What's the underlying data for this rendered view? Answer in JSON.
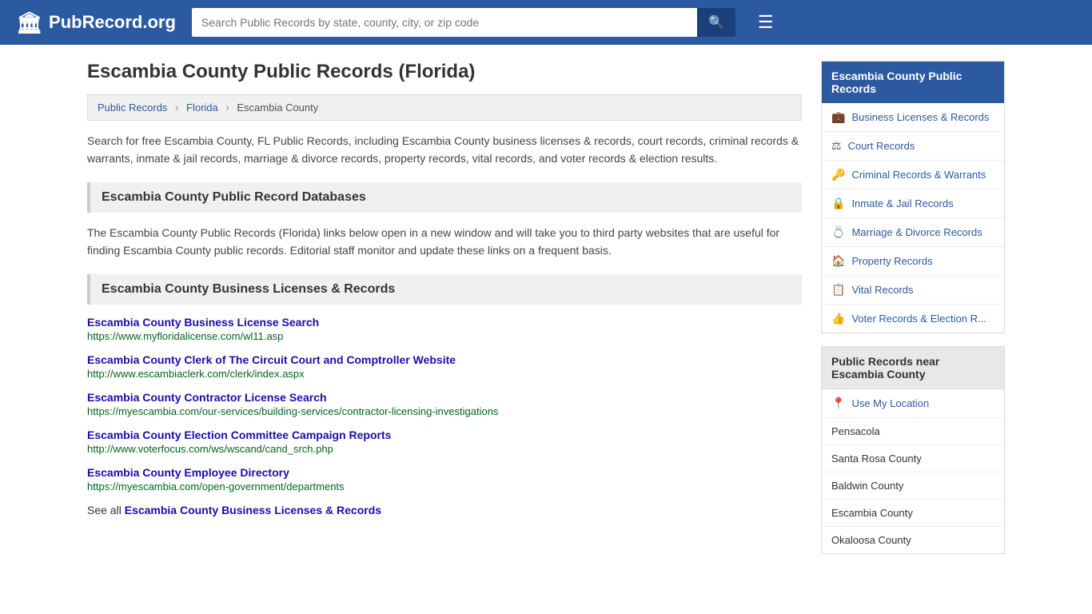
{
  "header": {
    "logo_icon": "🏛",
    "logo_text": "PubRecord.org",
    "search_placeholder": "Search Public Records by state, county, city, or zip code",
    "search_icon": "🔍",
    "menu_icon": "☰"
  },
  "page": {
    "title": "Escambia County Public Records (Florida)",
    "breadcrumb": {
      "items": [
        "Public Records",
        "Florida",
        "Escambia County"
      ]
    },
    "description": "Search for free Escambia County, FL Public Records, including Escambia County business licenses & records, court records, criminal records & warrants, inmate & jail records, marriage & divorce records, property records, vital records, and voter records & election results.",
    "databases_section": {
      "heading": "Escambia County Public Record Databases",
      "description": "The Escambia County Public Records (Florida) links below open in a new window and will take you to third party websites that are useful for finding Escambia County public records. Editorial staff monitor and update these links on a frequent basis."
    },
    "business_section": {
      "heading": "Escambia County Business Licenses & Records",
      "records": [
        {
          "title": "Escambia County Business License Search",
          "url": "https://www.myfloridalicense.com/wl11.asp"
        },
        {
          "title": "Escambia County Clerk of The Circuit Court and Comptroller Website",
          "url": "http://www.escambiaclerk.com/clerk/index.aspx"
        },
        {
          "title": "Escambia County Contractor License Search",
          "url": "https://myescambia.com/our-services/building-services/contractor-licensing-investigations"
        },
        {
          "title": "Escambia County Election Committee Campaign Reports",
          "url": "http://www.voterfocus.com/ws/wscand/cand_srch.php"
        },
        {
          "title": "Escambia County Employee Directory",
          "url": "https://myescambia.com/open-government/departments"
        }
      ],
      "see_all_label": "See all",
      "see_all_link_text": "Escambia County Business Licenses & Records"
    }
  },
  "sidebar": {
    "records_box": {
      "title": "Escambia County Public Records",
      "items": [
        {
          "icon": "💼",
          "label": "Business Licenses & Records"
        },
        {
          "icon": "⚖",
          "label": "Court Records"
        },
        {
          "icon": "🔑",
          "label": "Criminal Records & Warrants"
        },
        {
          "icon": "🔒",
          "label": "Inmate & Jail Records"
        },
        {
          "icon": "💍",
          "label": "Marriage & Divorce Records"
        },
        {
          "icon": "🏠",
          "label": "Property Records"
        },
        {
          "icon": "📋",
          "label": "Vital Records"
        },
        {
          "icon": "👍",
          "label": "Voter Records & Election R..."
        }
      ]
    },
    "nearby_box": {
      "title": "Public Records near Escambia County",
      "use_location": {
        "icon": "📍",
        "label": "Use My Location"
      },
      "locations": [
        "Pensacola",
        "Santa Rosa County",
        "Baldwin County",
        "Escambia County",
        "Okaloosa County"
      ]
    }
  }
}
